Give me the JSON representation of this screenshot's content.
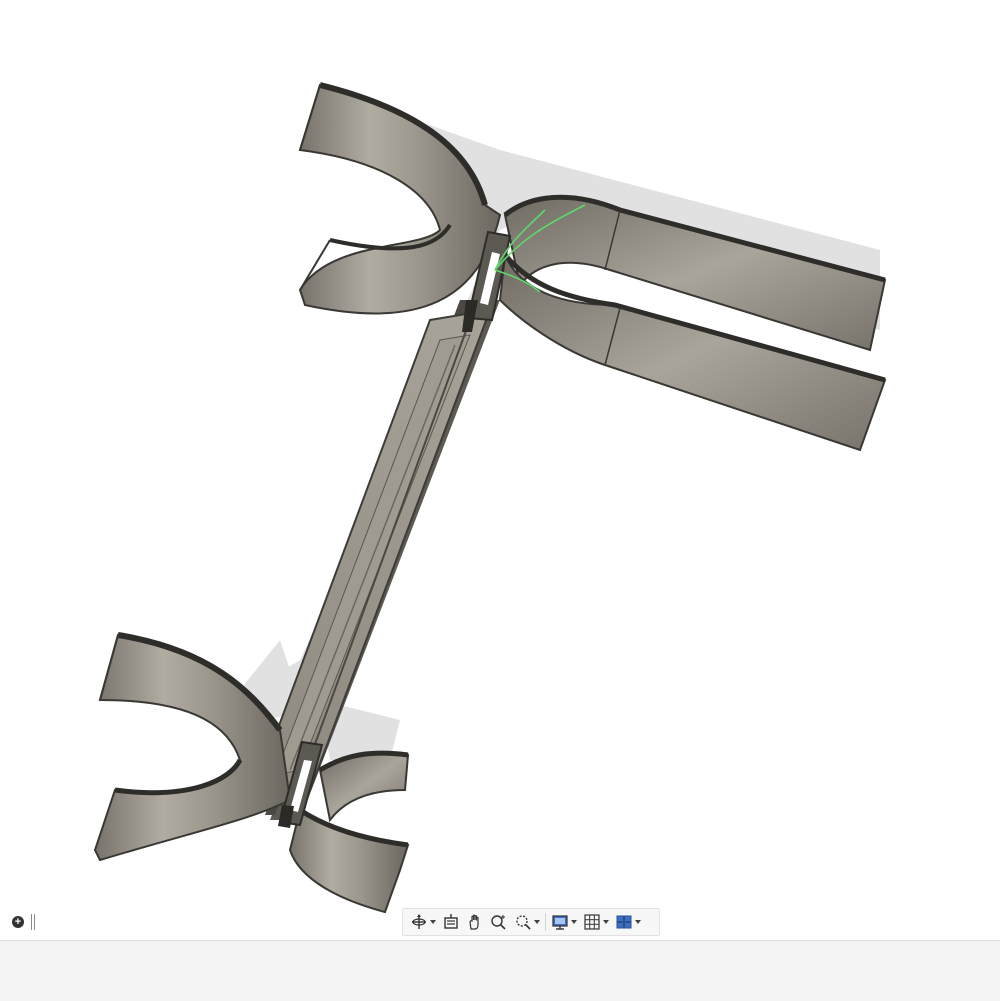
{
  "app": {
    "name": "CAD viewport",
    "model_color": "#8f8a80",
    "shadow_color": "#d9d9d9",
    "accent_stroke": "#5fd86a"
  },
  "left_controls": {
    "icons": [
      "add-circle-icon",
      "grip-handle-icon"
    ]
  },
  "nav_toolbar": {
    "items": [
      {
        "id": "orbit",
        "icon": "orbit-icon",
        "has_dropdown": true
      },
      {
        "id": "look-at",
        "icon": "look-at-icon",
        "has_dropdown": false
      },
      {
        "id": "pan",
        "icon": "pan-hand-icon",
        "has_dropdown": false
      },
      {
        "id": "zoom",
        "icon": "zoom-icon",
        "has_dropdown": false
      },
      {
        "id": "fit",
        "icon": "zoom-window-icon",
        "has_dropdown": true
      },
      {
        "id": "display-settings",
        "icon": "display-settings-icon",
        "has_dropdown": true
      },
      {
        "id": "grid-snaps",
        "icon": "grid-icon",
        "has_dropdown": true
      },
      {
        "id": "viewports",
        "icon": "viewports-icon",
        "has_dropdown": true
      }
    ]
  }
}
